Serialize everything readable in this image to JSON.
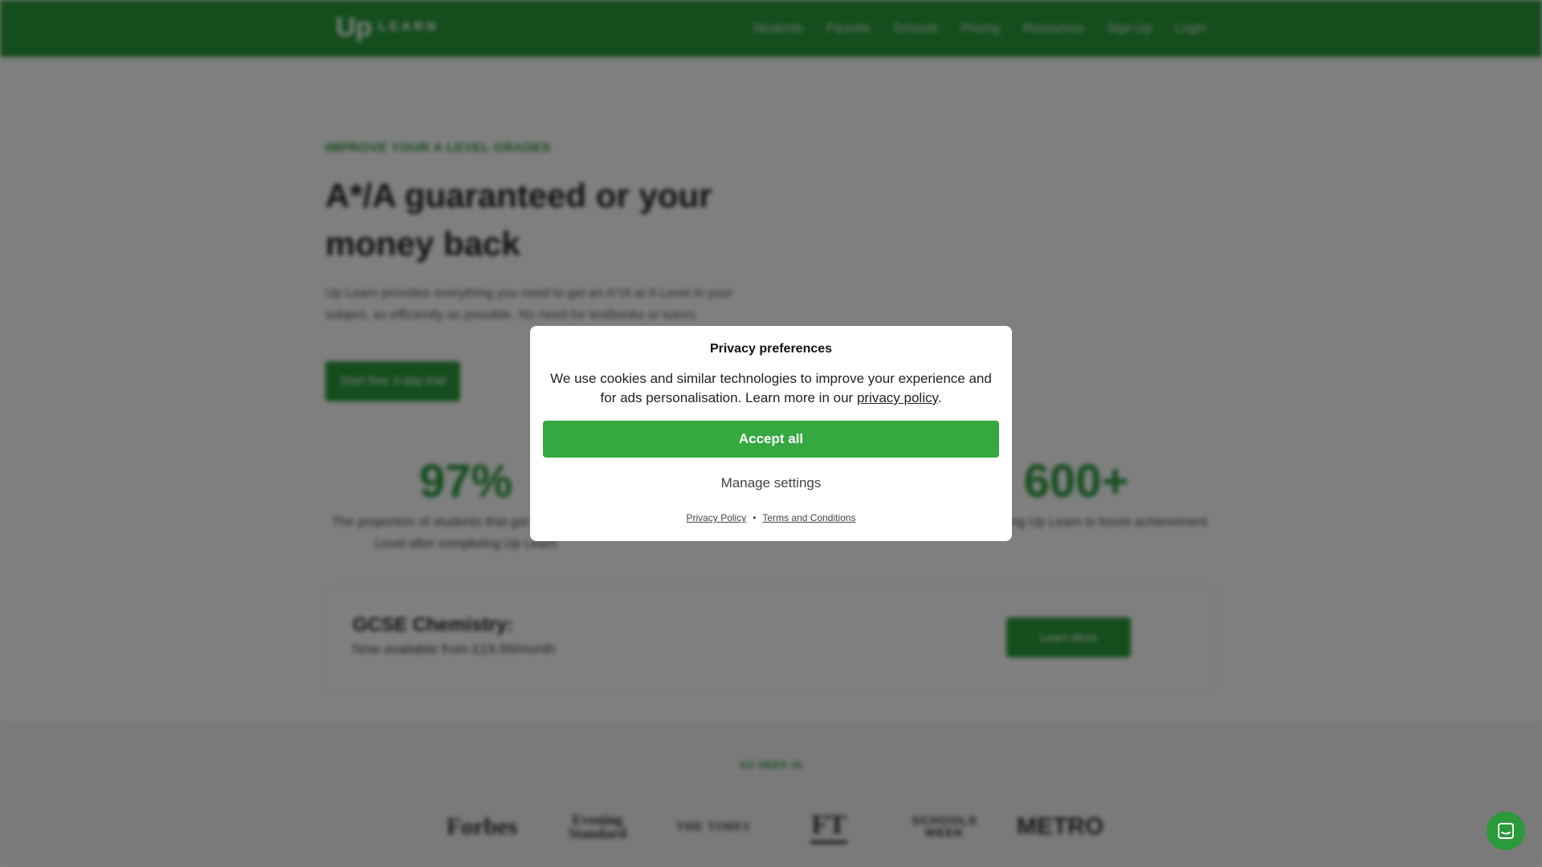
{
  "nav": {
    "logo_mark": "Up",
    "logo_word": "LEARN",
    "links": [
      "Students",
      "Parents",
      "Schools",
      "Pricing",
      "Resources",
      "Sign Up",
      "Login"
    ]
  },
  "hero": {
    "eyebrow": "IMPROVE YOUR A LEVEL GRADES",
    "headline": "A*/A guaranteed or your money back",
    "sub": "Up Learn provides everything you need to get an A*/A at A Level in your subject, as efficiently as possible. No need for textbooks or tutors.",
    "cta": "Start free 3-day trial"
  },
  "stats": [
    {
      "number": "97%",
      "text": "The proportion of students that got an A*/A at A Level after completing Up Learn"
    },
    {
      "number": "600+",
      "text": "Schools using Up Learn to boost achievement"
    }
  ],
  "promo": {
    "title": "GCSE Chemistry:",
    "subtitle": "Now available from £19.99/month",
    "button": "Learn More"
  },
  "press": {
    "label": "AS SEEN IN",
    "logos": {
      "forbes": "Forbes",
      "standard": "Evening Standard",
      "times": "THE TIMES",
      "ft": "FT",
      "schools_week": "SCHOOLS WEEK",
      "metro": "METRO"
    }
  },
  "privacy": {
    "title": "Privacy preferences",
    "body_prefix": "We use cookies and similar technologies to improve your experience and for ads personalisation. Learn more in our ",
    "body_link": "privacy policy",
    "body_suffix": ".",
    "accept": "Accept all",
    "manage": "Manage settings",
    "footer_privacy": "Privacy Policy",
    "footer_separator": "•",
    "footer_terms": "Terms and Conditions"
  },
  "colors": {
    "brand_green": "#2a9a3a",
    "accept_green": "#35a840"
  },
  "icons": {
    "chat": "chat-bubble-icon"
  }
}
